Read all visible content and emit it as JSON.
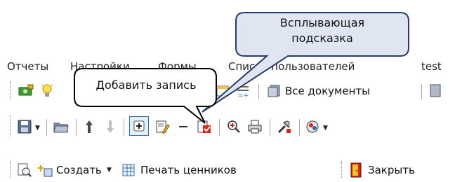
{
  "menu": {
    "items": [
      "Отчеты",
      "Настройки",
      "Формы",
      "Список пользователей",
      "test"
    ]
  },
  "callouts": {
    "popup_hint": "Всплывающая подсказка",
    "tooltip": "Добавить запись"
  },
  "toolbar1": {
    "all_documents_label": "Все документы"
  },
  "toolbar3": {
    "create_label": "Создать",
    "create_caret": "▼",
    "print_price_tags_label": "Печать ценников",
    "close_label": "Закрыть"
  },
  "icons": {
    "save": "save-icon",
    "open": "folder-open-icon",
    "up": "arrow-up-icon",
    "down": "arrow-down-icon",
    "add": "plus-icon",
    "edit": "edit-document-icon",
    "delete": "minus-icon",
    "post": "post-document-icon",
    "find": "magnifier-icon",
    "print": "printer-icon",
    "tools": "tools-icon",
    "zoom": "zoom-icon",
    "preview": "preview-icon",
    "new": "new-document-icon",
    "table": "table-icon",
    "exit": "exit-door-icon"
  },
  "colors": {
    "callout_fill": "#dfe6f2",
    "callout_border": "#2a3c66",
    "tooltip_border": "#000000",
    "active_button_border": "#3a6ea5",
    "active_button_fill": "#e3eef8"
  }
}
